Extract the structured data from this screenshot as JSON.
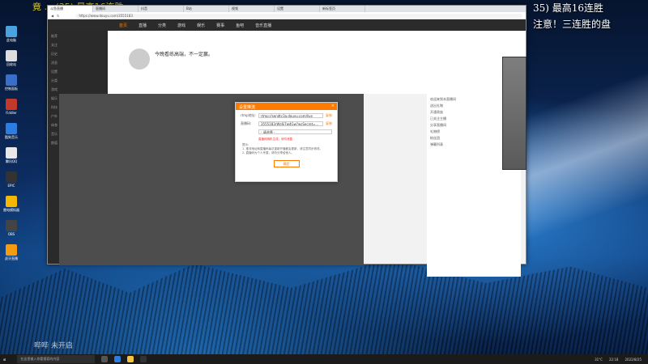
{
  "ticker": "竟 ... (35) 最高16连胜",
  "notice": {
    "line1": "35) 最高16连胜",
    "line2": "注意！三连胜的盘"
  },
  "desktop_icons": [
    "此电脑",
    "回收站",
    "控制面板",
    "Fiddler",
    "酷狗音乐",
    "腾讯QQ",
    "EPIC",
    "雷电模拟器",
    "OBS",
    "虎牙直播"
  ],
  "browser": {
    "tabs": [
      "斗鱼直播",
      "直播间",
      "抖音",
      "B站",
      "视频",
      "设置",
      "新标签页"
    ],
    "url": "https://www.douyu.com/3555183"
  },
  "site": {
    "nav": [
      "首页",
      "直播",
      "分类",
      "游戏",
      "娱乐",
      "赛事",
      "鱼吧",
      "音乐直播"
    ],
    "sidebar": [
      "推荐",
      "关注",
      "历史",
      "消息",
      "设置",
      "分类",
      "游戏",
      "娱乐",
      "科技",
      "户外",
      "体育",
      "音乐",
      "颜值"
    ],
    "room_title": "今晚看练高端，不一定赢。",
    "chat_lines": [
      "欢迎来到本直播间",
      "送出礼物",
      "开通贵族",
      "已关注主播",
      "分享直播间",
      "礼物榜",
      "粉丝团",
      "弹幕列表"
    ]
  },
  "dialog": {
    "title": "设置推流",
    "rtmp_label": "rtmp地址:",
    "rtmp_value": "rtmp://sendtc3a.douyu.com/live",
    "key_label": "直播码:",
    "key_value": "3555183rWs6i7w4Gw?wsSecret=...",
    "copy": "复制",
    "select_value": "- 请选择 -",
    "warning": "直播码随机生成，请勿泄露",
    "tips_title": "提示:",
    "tip1": "1. 推流地址和直播码每次重新开播都会更新，请注意同步修改。",
    "tip2": "2. 直播码为个人专属，请勿分享给他人。",
    "ok": "确定"
  },
  "taskbar": {
    "search": "在这里输入你要搜索的内容",
    "time": "22:18",
    "date": "2022/8/25",
    "temp": "31°C"
  },
  "watermark": "哔哔 未开启"
}
